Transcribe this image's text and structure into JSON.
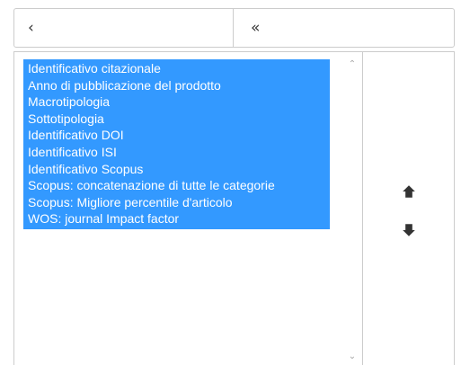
{
  "toolbar": {
    "move_left_glyph": "‹",
    "move_all_left_glyph": "«"
  },
  "list": {
    "items": [
      "Identificativo citazionale",
      "Anno di pubblicazione del prodotto",
      "Macrotipologia",
      "Sottotipologia",
      "Identificativo DOI",
      "Identificativo ISI",
      "Identificativo Scopus",
      "Scopus: concatenazione di tutte le categorie",
      "Scopus: Migliore percentile d'articolo",
      "WOS: journal Impact factor"
    ],
    "selected_color": "#3399ff"
  },
  "scrollbar": {
    "up_glyph": "⌃",
    "down_glyph": "⌄"
  },
  "order_controls": {
    "move_up_icon": "arrow-up-icon",
    "move_down_icon": "arrow-down-icon"
  }
}
